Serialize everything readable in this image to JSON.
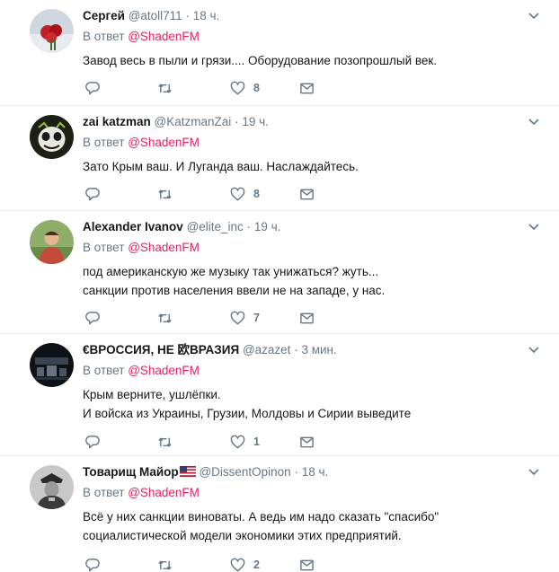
{
  "tweets": [
    {
      "name": "Сергей",
      "handle": "@atoll711",
      "time": "18 ч.",
      "reply_prefix": "В ответ",
      "reply_to": "@ShadenFM",
      "lines": [
        "Завод весь в пыли и грязи.... Оборудование позопрошлый век."
      ],
      "likes": "8",
      "avatar": "roses-photo"
    },
    {
      "name": "zai katzman",
      "handle": "@KatzmanZai",
      "time": "19 ч.",
      "reply_prefix": "В ответ",
      "reply_to": "@ShadenFM",
      "lines": [
        "Зато Крым ваш. И Луганда ваш. Наслаждайтесь."
      ],
      "likes": "8",
      "avatar": "skull-face"
    },
    {
      "name": "Alexander Ivanov",
      "handle": "@elite_inc",
      "time": "19 ч.",
      "reply_prefix": "В ответ",
      "reply_to": "@ShadenFM",
      "lines": [
        "под американскую же музыку так унижаться? жуть...",
        "санкции против населения ввели не на западе, у нас."
      ],
      "likes": "7",
      "avatar": "man-outdoors"
    },
    {
      "name": "€ВРОССИЯ, НЕ 欧ВРАЗИЯ",
      "handle": "@azazet",
      "time": "3 мин.",
      "reply_prefix": "В ответ",
      "reply_to": "@ShadenFM",
      "lines": [
        "Крым верните, ушлёпки.",
        "И войска из Украины, Грузии, Молдовы и Сирии выведите"
      ],
      "likes": "1",
      "avatar": "dark-skyline"
    },
    {
      "name": "Товарищ Майор",
      "handle": "@DissentOpinon",
      "time": "18 ч.",
      "reply_prefix": "В ответ",
      "reply_to": "@ShadenFM",
      "lines": [
        "Всё у них санкции виноваты. А ведь им надо сказать \"спасибо\"",
        "социалистической модели экономики этих предприятий."
      ],
      "likes": "2",
      "avatar": "officer-portrait",
      "flag": "us-flag-icon"
    }
  ],
  "colors": {
    "name": "#14171a",
    "muted": "#657786",
    "link": "#e0245e",
    "divider": "#e6ecf0",
    "icon": "#657786"
  },
  "icons": [
    "reply-icon",
    "retweet-icon",
    "like-icon",
    "direct-message-icon",
    "chevron-down-icon"
  ]
}
